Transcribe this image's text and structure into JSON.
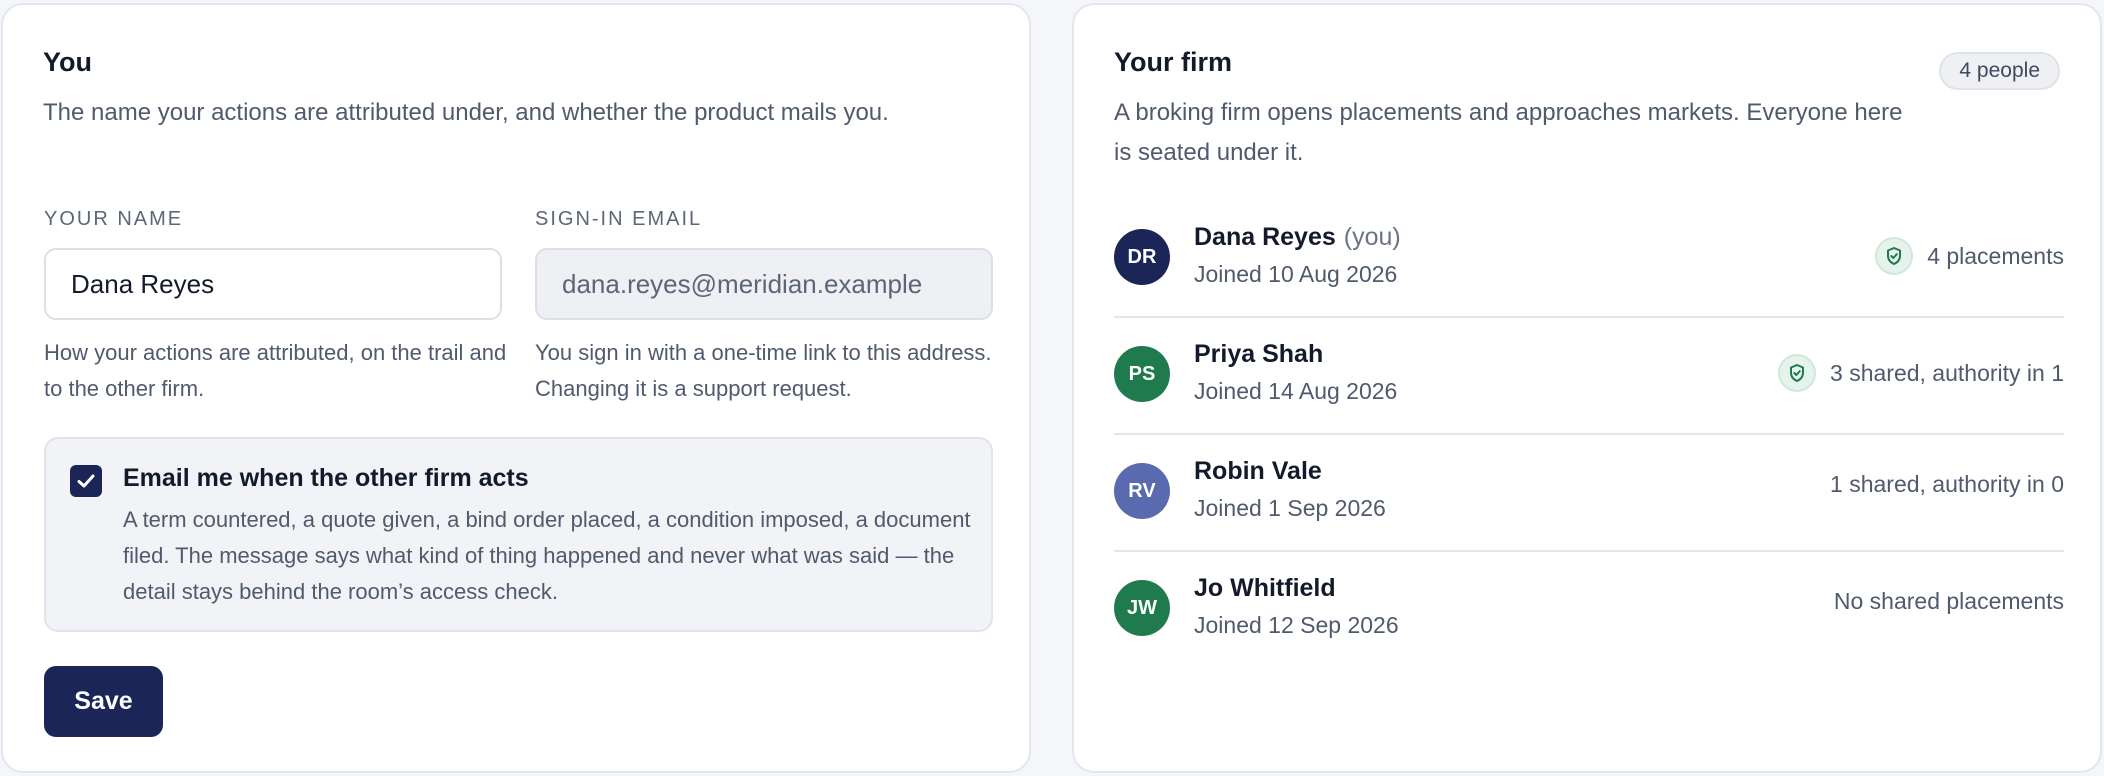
{
  "you_section": {
    "title": "You",
    "description": "The name your actions are attributed under, and whether the product mails you.",
    "name_field": {
      "label": "Your name",
      "value": "Dana Reyes",
      "help": "How your actions are attributed, on the trail and to the other firm."
    },
    "email_field": {
      "label": "Sign-in email",
      "value": "dana.reyes@meridian.example",
      "help": "You sign in with a one-time link to this address. Changing it is a support request."
    },
    "notification": {
      "checked": true,
      "title": "Email me when the other firm acts",
      "description": "A term countered, a quote given, a bind order placed, a condition imposed, a document filed. The message says what kind of thing happened and never what was said — the detail stays behind the room’s access check."
    },
    "save_label": "Save"
  },
  "firm_section": {
    "title": "Your firm",
    "count_badge": "4 people",
    "description": "A broking firm opens placements and approaches markets. Everyone here is seated under it.",
    "members": [
      {
        "initials": "DR",
        "avatar_color": "#1b2558",
        "name": "Dana Reyes",
        "you_tag": "(you)",
        "joined": "Joined 10 Aug 2026",
        "summary": "4 placements",
        "shield": true
      },
      {
        "initials": "PS",
        "avatar_color": "#1f7a4d",
        "name": "Priya Shah",
        "you_tag": "",
        "joined": "Joined 14 Aug 2026",
        "summary": "3 shared, authority in 1",
        "shield": true
      },
      {
        "initials": "RV",
        "avatar_color": "#5a6aae",
        "name": "Robin Vale",
        "you_tag": "",
        "joined": "Joined 1 Sep 2026",
        "summary": "1 shared, authority in 0",
        "shield": false
      },
      {
        "initials": "JW",
        "avatar_color": "#1f7a4d",
        "name": "Jo Whitfield",
        "you_tag": "",
        "joined": "Joined 12 Sep 2026",
        "summary": "No shared placements",
        "shield": false
      }
    ]
  },
  "colors": {
    "accent": "#1b2558",
    "shield_green": "#1f7a4d"
  },
  "icons": {
    "checkbox": "checkmark-icon",
    "authority": "shield-check-icon"
  }
}
